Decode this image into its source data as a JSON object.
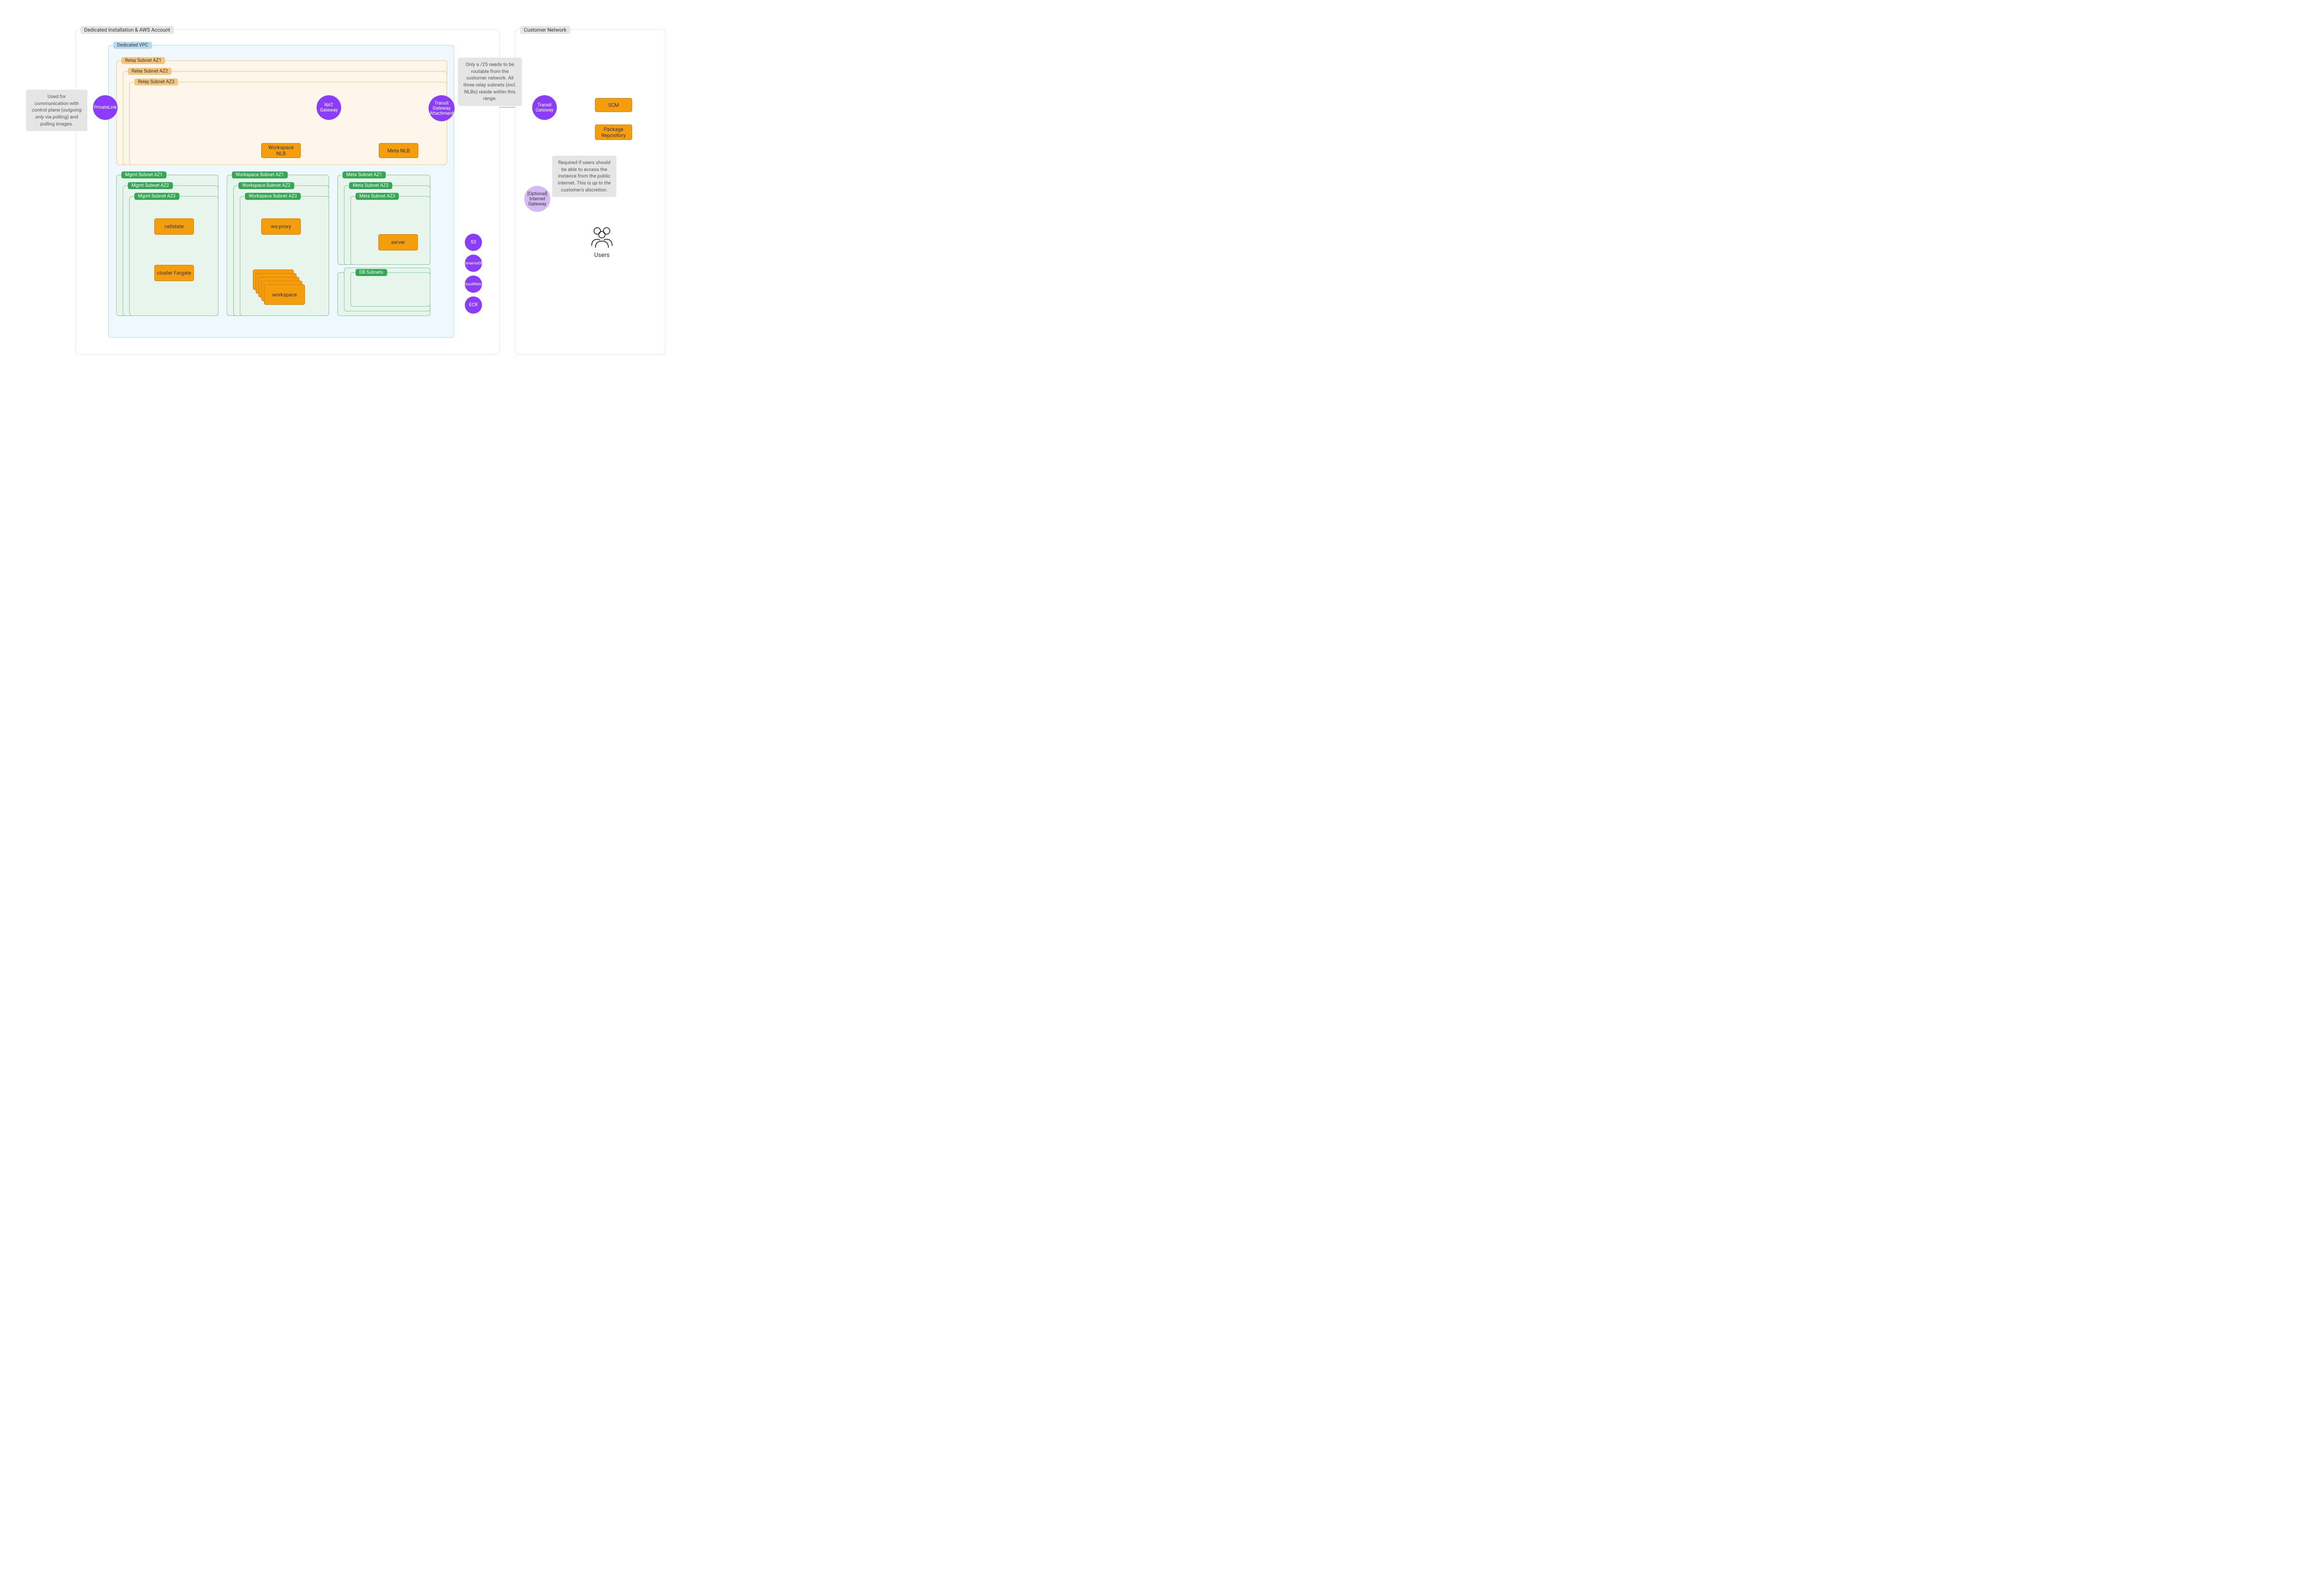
{
  "containers": {
    "dedicated": "Dedicated Installation & AWS Account",
    "customer": "Customer Network",
    "vpc": "Dedicated VPC"
  },
  "relay_subnets": [
    "Relay Subnet AZ1",
    "Relay Subnet AZ2",
    "Relay Subnet AZ3"
  ],
  "mgmt_subnets": [
    "Mgmt Subnet AZ1",
    "Mgmt Subnet AZ2",
    "Mgmt Subnet AZ3"
  ],
  "workspace_subnets": [
    "Workspace Subnet AZ1",
    "Workspace Subnet AZ2",
    "Workspace Subnet AZ3"
  ],
  "meta_subnets": [
    "Meta Subnet AZ1",
    "Meta Subnet AZ2",
    "Meta Subnet AZ3"
  ],
  "db_subnets": "DB Subnets",
  "circles": {
    "privatelink": "PrivateLink",
    "nat": "NAT Gateway",
    "tga": "Transit Gateway Attachment",
    "tg": "Transit Gateway",
    "igw": "[Optional] Internet Gateway",
    "s3": "S3",
    "dynamodb": "DynamoDB",
    "cloudwatch": "CloudWatch",
    "ecr": "ECR"
  },
  "boxes": {
    "workspace_nlb": "Workspace NLB",
    "meta_nlb": "Meta NLB",
    "cellstate": "cellstate",
    "cluster_fargate": "cluster Fargate",
    "ws_proxy": "ws-proxy",
    "workspace": "workspace",
    "server": "server",
    "scm": "SCM",
    "package_repo": "Package Repository"
  },
  "notes": {
    "left": "Used for communication with control plane (outgoing only via polling) and pulling images.",
    "left_pre": "Used for communication with control plane (",
    "left_em": "outgoing only",
    "left_post": " via polling) and pulling images.",
    "top": "Only a /25 needs to be routable from the customer network. All three relay subnets (incl. NLBs) reside within this range.",
    "right_pre": "Required if users should be able to access the instance from the public internet. This is ",
    "right_em": "up to the customer's discretion",
    "right_post": "."
  },
  "users": "Users"
}
